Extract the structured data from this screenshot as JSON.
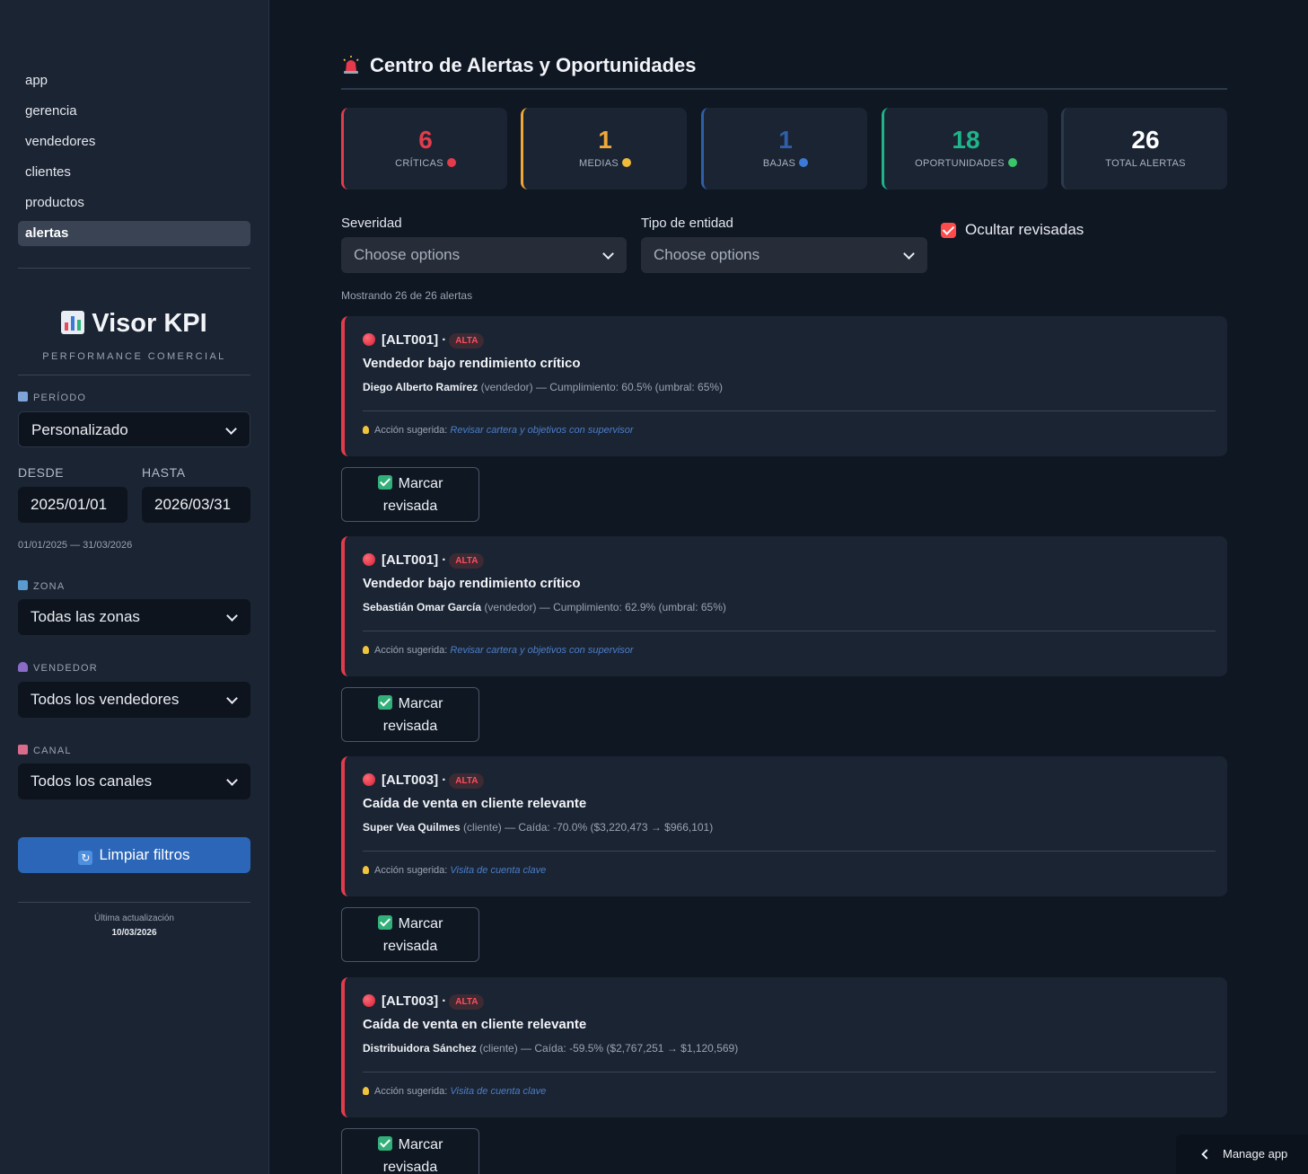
{
  "sidebar": {
    "nav": [
      "app",
      "gerencia",
      "vendedores",
      "clientes",
      "productos",
      "alertas"
    ],
    "active_nav": "alertas",
    "brand": "Visor KPI",
    "brand_sub": "PERFORMANCE COMERCIAL",
    "periodo_label": "PERÍODO",
    "periodo_value": "Personalizado",
    "desde_label": "DESDE",
    "hasta_label": "HASTA",
    "desde_value": "2025/01/01",
    "hasta_value": "2026/03/31",
    "range_note": "01/01/2025 — 31/03/2026",
    "zona_label": "ZONA",
    "zona_value": "Todas las zonas",
    "vendedor_label": "VENDEDOR",
    "vendedor_value": "Todos los vendedores",
    "canal_label": "CANAL",
    "canal_value": "Todos los canales",
    "clear_button": "Limpiar filtros",
    "updated_label": "Última actualización",
    "updated_value": "10/03/2026"
  },
  "main": {
    "title": "Centro de Alertas y Oportunidades",
    "stats": [
      {
        "value": "6",
        "label": "CRÍTICAS",
        "color": "#e23c4b"
      },
      {
        "value": "1",
        "label": "MEDIAS",
        "color": "#f0a73a"
      },
      {
        "value": "1",
        "label": "BAJAS",
        "color": "#2f5fa8"
      },
      {
        "value": "18",
        "label": "OPORTUNIDADES",
        "color": "#1fb58a"
      },
      {
        "value": "26",
        "label": "TOTAL ALERTAS",
        "color": "#ffffff"
      }
    ],
    "severidad_label": "Severidad",
    "severidad_placeholder": "Choose options",
    "tipo_label": "Tipo de entidad",
    "tipo_placeholder": "Choose options",
    "ocultar_label": "Ocultar revisadas",
    "showing": "Mostrando 26 de 26 alertas",
    "action_prefix": "Acción sugerida:",
    "mark_line1": "Marcar",
    "mark_line2": "revisada",
    "alerts": [
      {
        "id": "[ALT001] ·",
        "badge": "ALTA",
        "title": "Vendedor bajo rendimiento crítico",
        "entity": "Diego Alberto Ramírez",
        "detail": " (vendedor) — Cumplimiento: 60.5% (umbral: 65%)",
        "action": "Revisar cartera y objetivos con supervisor"
      },
      {
        "id": "[ALT001] ·",
        "badge": "ALTA",
        "title": "Vendedor bajo rendimiento crítico",
        "entity": "Sebastián Omar García",
        "detail": " (vendedor) — Cumplimiento: 62.9% (umbral: 65%)",
        "action": "Revisar cartera y objetivos con supervisor"
      },
      {
        "id": "[ALT003] ·",
        "badge": "ALTA",
        "title": "Caída de venta en cliente relevante",
        "entity": "Super Vea Quilmes",
        "detail": " (cliente) — Caída: -70.0% ($3,220,473 → $966,101)",
        "action": "Visita de cuenta clave"
      },
      {
        "id": "[ALT003] ·",
        "badge": "ALTA",
        "title": "Caída de venta en cliente relevante",
        "entity": "Distribuidora Sánchez",
        "detail": " (cliente) — Caída: -59.5% ($2,767,251 → $1,120,569)",
        "action": "Visita de cuenta clave"
      }
    ],
    "manage_app": "Manage app"
  }
}
